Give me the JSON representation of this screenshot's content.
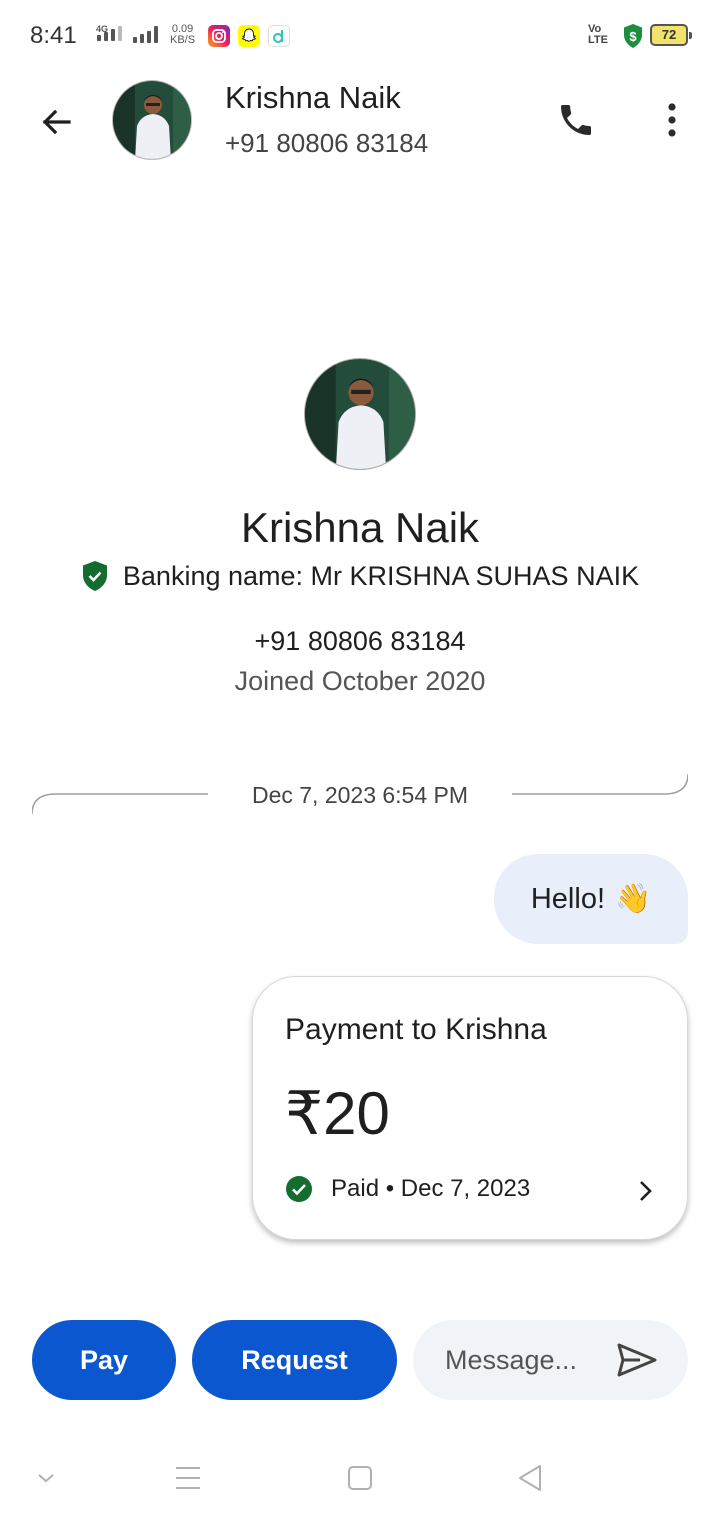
{
  "status_bar": {
    "time": "8:41",
    "network": "4G",
    "speed_value": "0.09",
    "speed_unit": "KB/S",
    "volte_line1": "Vo",
    "volte_line2": "LTE",
    "battery": "72"
  },
  "header": {
    "contact_name": "Krishna Naik",
    "contact_phone": "+91 80806 83184"
  },
  "profile": {
    "name": "Krishna Naik",
    "banking_name": "Banking name: Mr KRISHNA SUHAS NAIK",
    "phone": "+91 80806 83184",
    "joined": "Joined October 2020"
  },
  "conversation": {
    "date_divider": "Dec 7, 2023 6:54 PM",
    "message_text": "Hello!",
    "message_emoji": "👋",
    "payment": {
      "title": "Payment to Krishna",
      "amount": "₹20",
      "status": "Paid • Dec 7, 2023"
    }
  },
  "bottom_bar": {
    "pay_label": "Pay",
    "request_label": "Request",
    "message_placeholder": "Message..."
  },
  "colors": {
    "primary": "#0b57d0",
    "success": "#146c2e",
    "bubble": "#e8effb",
    "input_bg": "#f0f4f9"
  }
}
